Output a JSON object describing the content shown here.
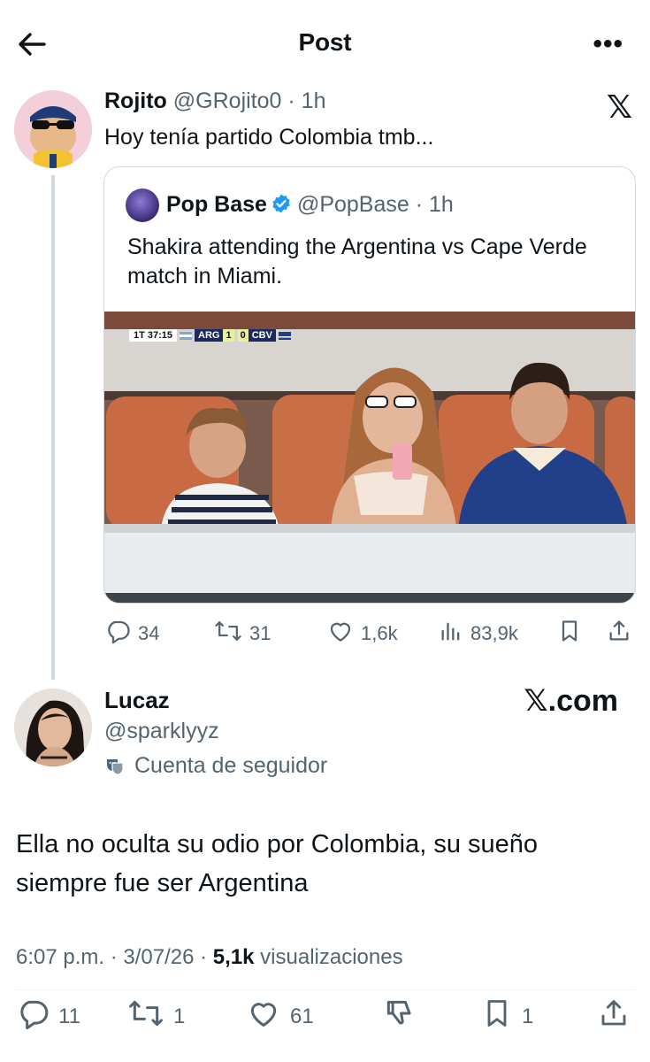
{
  "header": {
    "title": "Post"
  },
  "quoting_post": {
    "name": "Rojito",
    "handle": "@GRojito0",
    "time": "· 1h",
    "text": "Hoy tenía partido Colombia tmb...",
    "corner_logo": "𝕏"
  },
  "quoted_post": {
    "name": "Pop Base",
    "handle": "@PopBase",
    "time": "· 1h",
    "text": "Shakira attending the Argentina vs Cape Verde match in Miami.",
    "scoreboard": {
      "clock": "1T 37:15",
      "team_home": "ARG",
      "score_home": "1",
      "score_away": "0",
      "team_away": "CBV"
    },
    "stats": {
      "replies": "34",
      "reposts": "31",
      "likes": "1,6k",
      "views": "83,9k"
    }
  },
  "main_post": {
    "name": "Lucaz",
    "handle": "@sparklyyz",
    "account_label": "Cuenta de seguidor",
    "watermark": "𝕏.com",
    "text": "Ella no oculta su odio por Colombia, su sueño siempre fue ser Argentina",
    "timestamp": "6:07 p.m. · 3/07/26 · ",
    "views_count": "5,1k",
    "views_label": " visualizaciones",
    "actions": {
      "replies": "11",
      "reposts": "1",
      "likes": "61",
      "bookmarks": "1"
    }
  },
  "colors": {
    "text": "#0f1419",
    "secondary": "#536471",
    "verified": "#1d9bf0",
    "border": "#cfd9de"
  }
}
